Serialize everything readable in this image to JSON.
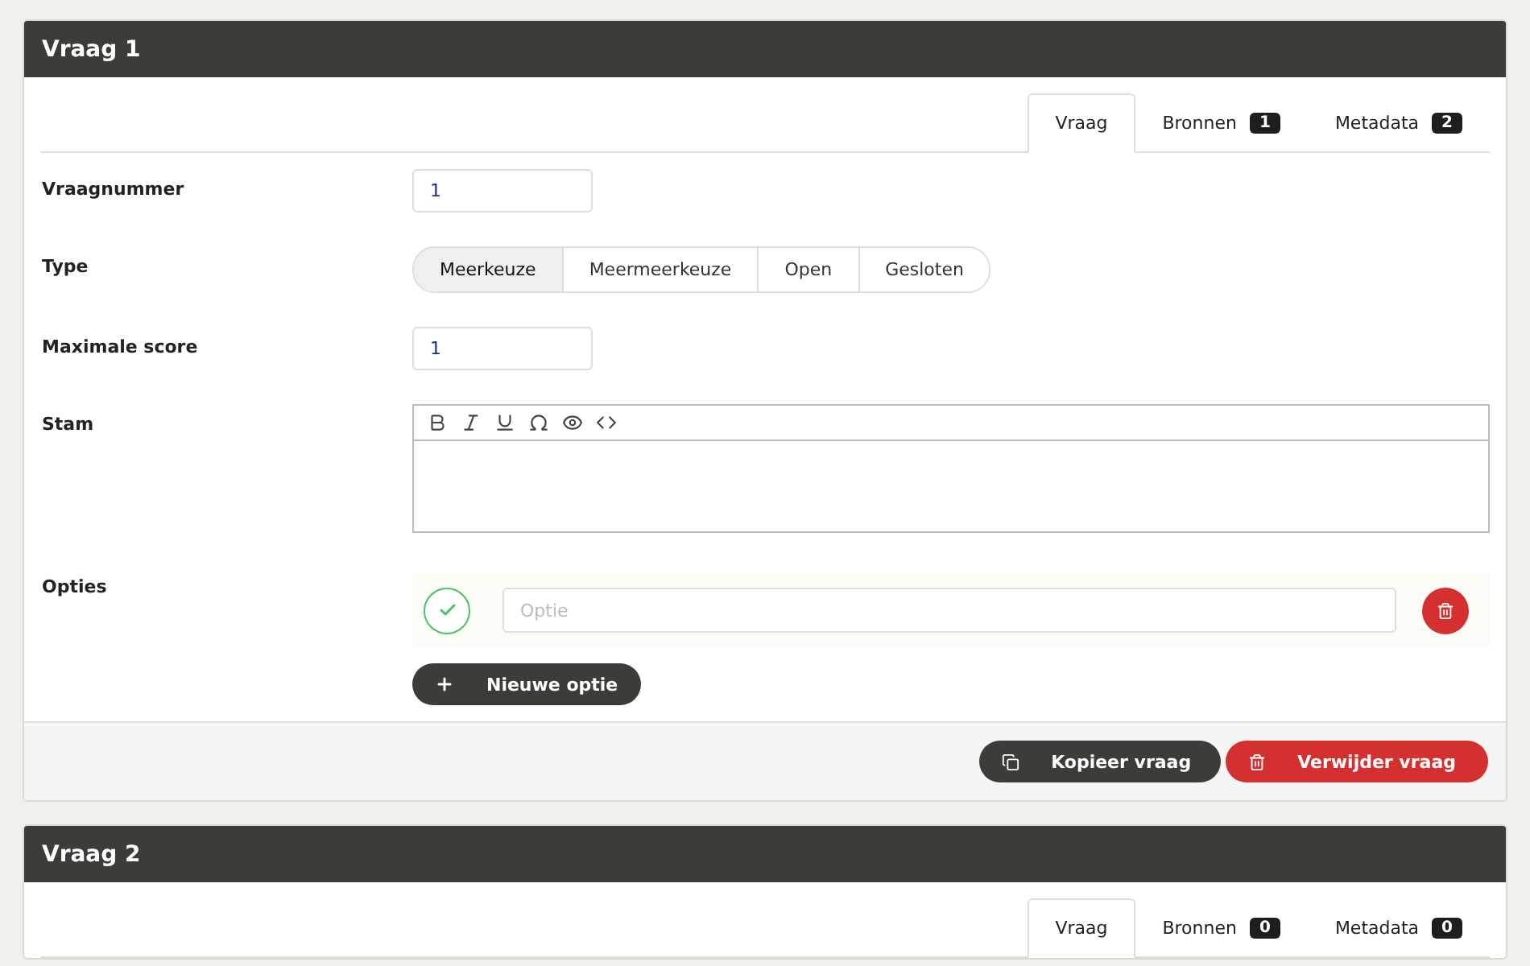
{
  "questions": [
    {
      "title": "Vraag 1",
      "tabs": [
        {
          "label": "Vraag",
          "selected": true
        },
        {
          "label": "Bronnen",
          "count": "1",
          "selected": false
        },
        {
          "label": "Metadata",
          "count": "2",
          "selected": false
        }
      ],
      "fields": [
        {
          "kind": "input",
          "label": "Vraagnummer",
          "value": "1"
        },
        {
          "kind": "segmented",
          "label": "Type",
          "options": [
            {
              "label": "Meerkeuze",
              "selected": true
            },
            {
              "label": "Meermeerkeuze",
              "selected": false
            },
            {
              "label": "Open",
              "selected": false
            },
            {
              "label": "Gesloten",
              "selected": false
            }
          ]
        },
        {
          "kind": "input",
          "label": "Maximale score",
          "value": "1"
        },
        {
          "kind": "editor",
          "label": "Stam"
        },
        {
          "kind": "options",
          "label": "Opties",
          "options": [
            {
              "placeholder": "Optie",
              "correct": true
            }
          ],
          "add_button": "Nieuwe optie"
        }
      ],
      "actions": [
        {
          "kind": "copy",
          "label": "Kopieer vraag"
        },
        {
          "kind": "delete",
          "label": "Verwijder vraag"
        }
      ]
    },
    {
      "title": "Vraag 2",
      "tabs": [
        {
          "label": "Vraag",
          "selected": true
        },
        {
          "label": "Bronnen",
          "count": "0",
          "selected": false
        },
        {
          "label": "Metadata",
          "count": "0",
          "selected": false
        }
      ]
    }
  ]
}
